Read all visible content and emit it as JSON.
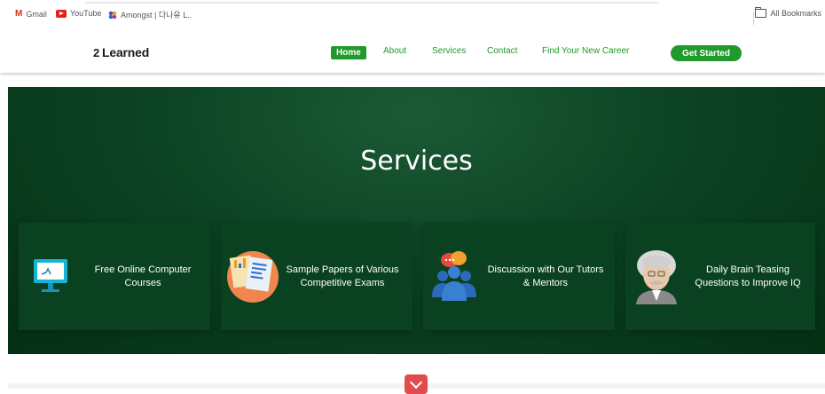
{
  "bookmarks": {
    "items": [
      {
        "label": "Gmail",
        "icon": "gmail-icon"
      },
      {
        "label": "YouTube",
        "icon": "youtube-icon"
      },
      {
        "label": "Amongst | 다나유 L..",
        "icon": "amongst-icon"
      }
    ],
    "all_bookmarks": "All Bookmarks"
  },
  "header": {
    "logo_text": "Learned",
    "logo_mark": "2",
    "nav": [
      "Home",
      "About",
      "Services",
      "Contact",
      "Find Your New Career"
    ],
    "cta": "Get Started",
    "accent_color": "#1f9a2b"
  },
  "hero": {
    "title": "Services",
    "cards": [
      {
        "title_line1": "Free Online Computer",
        "title_line2": "Courses",
        "icon": "computer-monitor-icon"
      },
      {
        "title_line1": "Sample Papers of Various",
        "title_line2": "Competitive Exams",
        "icon": "papers-icon"
      },
      {
        "title_line1": "Discussion with Our Tutors",
        "title_line2": "& Mentors",
        "icon": "discussion-group-icon"
      },
      {
        "title_line1": "Daily Brain Teasing",
        "title_line2": "Questions to Improve IQ",
        "icon": "einstein-avatar-icon"
      }
    ],
    "background_color": "#0c4424"
  },
  "scroll_button": {
    "icon": "chevron-down-icon",
    "color": "#e14b4b"
  }
}
